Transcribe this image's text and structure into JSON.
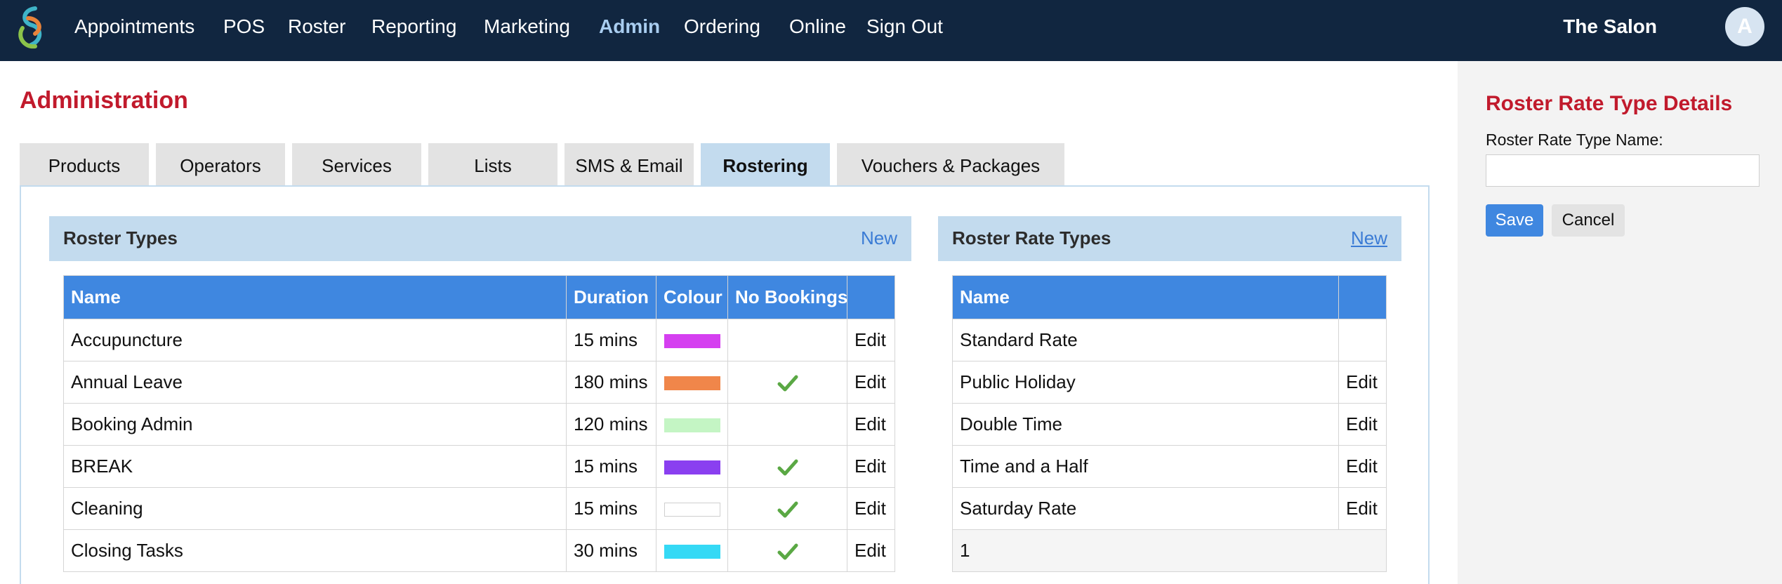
{
  "nav": {
    "items": [
      {
        "label": "Appointments",
        "active": false
      },
      {
        "label": "POS",
        "active": false
      },
      {
        "label": "Roster",
        "active": false
      },
      {
        "label": "Reporting",
        "active": false
      },
      {
        "label": "Marketing",
        "active": false
      },
      {
        "label": "Admin",
        "active": true
      },
      {
        "label": "Ordering",
        "active": false
      },
      {
        "label": "Online",
        "active": false
      },
      {
        "label": "Sign Out",
        "active": false
      }
    ],
    "salon_name": "The Salon",
    "avatar_initial": "A",
    "logo_icon": "swirl-logo-icon"
  },
  "page": {
    "title": "Administration",
    "tabs": [
      {
        "label": "Products",
        "active": false
      },
      {
        "label": "Operators",
        "active": false
      },
      {
        "label": "Services",
        "active": false
      },
      {
        "label": "Lists",
        "active": false
      },
      {
        "label": "SMS & Email",
        "active": false
      },
      {
        "label": "Rostering",
        "active": true
      },
      {
        "label": "Vouchers & Packages",
        "active": false
      }
    ]
  },
  "roster_types": {
    "title": "Roster Types",
    "new_label": "New",
    "columns": [
      "Name",
      "Duration",
      "Colour",
      "No Bookings",
      ""
    ],
    "rows": [
      {
        "name": "Accupuncture",
        "duration": "15 mins",
        "colour": "#d53ff0",
        "no_bookings": false,
        "edit": "Edit"
      },
      {
        "name": "Annual Leave",
        "duration": "180 mins",
        "colour": "#f0864a",
        "no_bookings": true,
        "edit": "Edit"
      },
      {
        "name": "Booking Admin",
        "duration": "120 mins",
        "colour": "#c4f5c4",
        "no_bookings": false,
        "edit": "Edit"
      },
      {
        "name": "BREAK",
        "duration": "15 mins",
        "colour": "#8a3ff0",
        "no_bookings": true,
        "edit": "Edit"
      },
      {
        "name": "Cleaning",
        "duration": "15 mins",
        "colour": "#ffffff",
        "no_bookings": true,
        "edit": "Edit"
      },
      {
        "name": "Closing Tasks",
        "duration": "30 mins",
        "colour": "#35d9f5",
        "no_bookings": true,
        "edit": "Edit"
      }
    ]
  },
  "roster_rate_types": {
    "title": "Roster Rate Types",
    "new_label": "New",
    "columns": [
      "Name",
      ""
    ],
    "rows": [
      {
        "name": "Standard Rate",
        "edit": ""
      },
      {
        "name": "Public Holiday",
        "edit": "Edit"
      },
      {
        "name": "Double Time",
        "edit": "Edit"
      },
      {
        "name": "Time and a Half",
        "edit": "Edit"
      },
      {
        "name": "Saturday Rate",
        "edit": "Edit"
      }
    ],
    "footer": "1"
  },
  "details": {
    "title": "Roster Rate Type Details",
    "name_label": "Roster Rate Type Name:",
    "name_value": "",
    "name_placeholder": "",
    "save_label": "Save",
    "cancel_label": "Cancel"
  },
  "colors": {
    "topbar": "#112640",
    "accent_blue": "#3f87e0",
    "title_red": "#c11a2c",
    "tab_active": "#c3dbee",
    "check_green": "#5aa844"
  }
}
